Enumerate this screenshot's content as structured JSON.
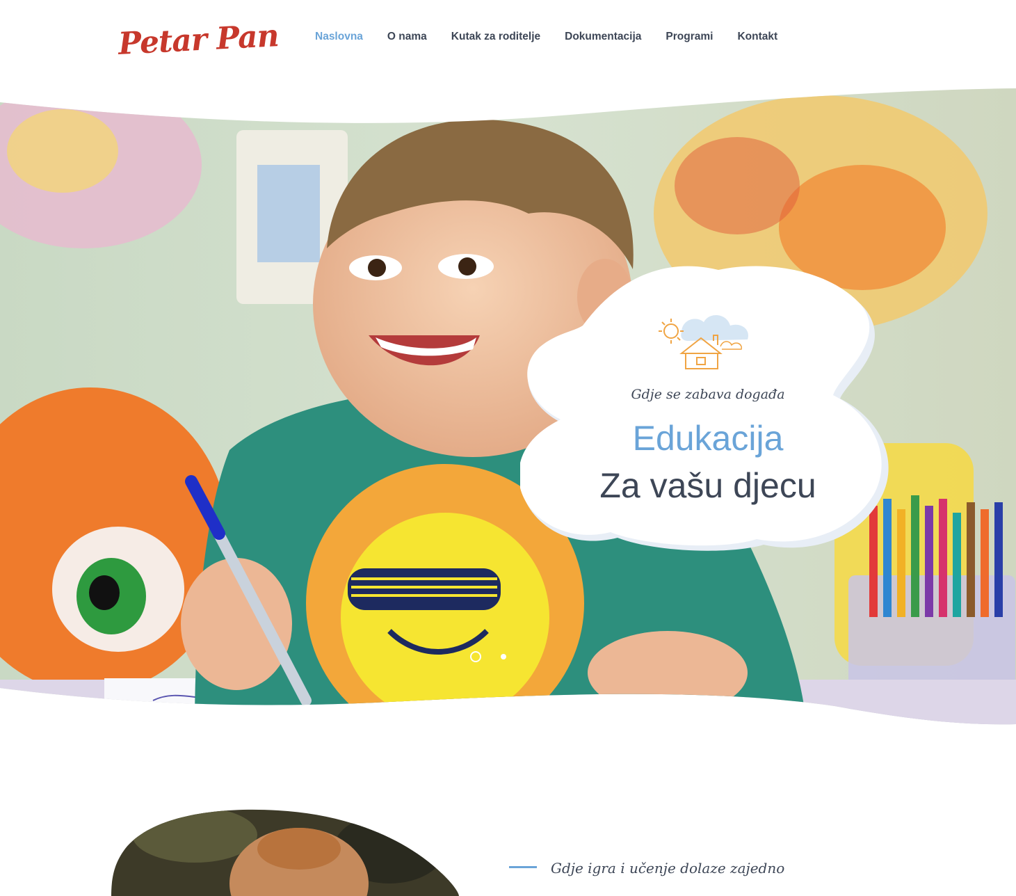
{
  "header": {
    "logo_text": "Petar Pan",
    "nav": [
      {
        "label": "Naslovna",
        "active": true
      },
      {
        "label": "O nama",
        "active": false
      },
      {
        "label": "Kutak za roditelje",
        "active": false
      },
      {
        "label": "Dokumentacija",
        "active": false
      },
      {
        "label": "Programi",
        "active": false
      },
      {
        "label": "Kontakt",
        "active": false
      }
    ]
  },
  "hero": {
    "tagline": "Gdje se zabava događa",
    "title": "Edukacija",
    "subtitle": "Za vašu djecu",
    "slider": {
      "total": 2,
      "current": 1
    },
    "icon": "sun-house-clouds-icon"
  },
  "about": {
    "tagline": "Gdje igra i učenje dolaze zajedno",
    "title": ""
  },
  "colors": {
    "accent_blue": "#6aa4d8",
    "text_dark": "#3d4656",
    "logo_red": "#c7382c",
    "icon_orange": "#f0a443"
  }
}
